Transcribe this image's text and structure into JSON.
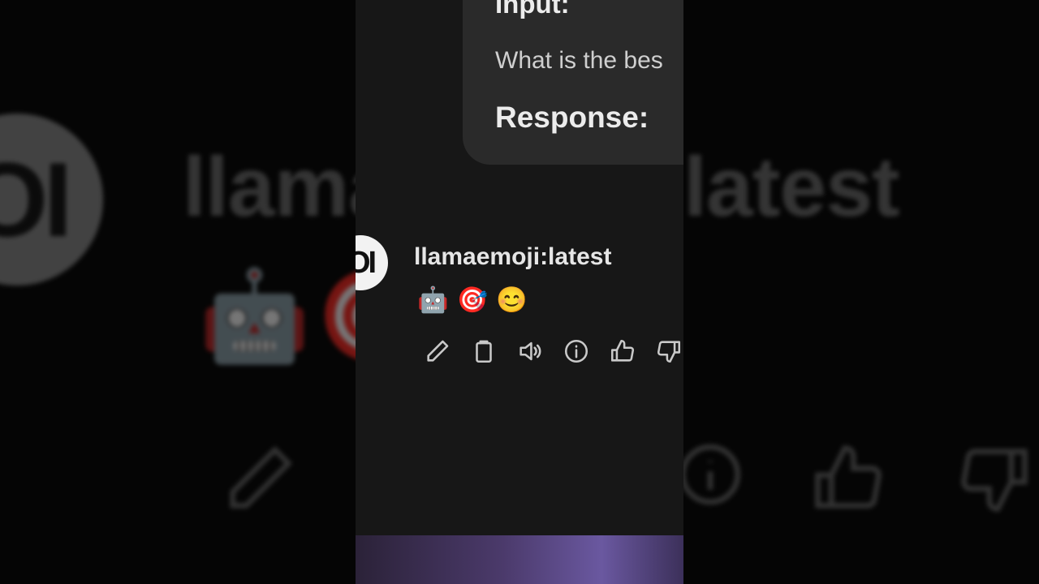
{
  "background": {
    "avatar_text": "OI",
    "title_left": "llama",
    "title_right": "latest",
    "emojis": [
      "🤖",
      "🎯"
    ]
  },
  "chat": {
    "user_message": {
      "input_label": "Input:",
      "text": "What is the bes",
      "response_label": "Response:"
    },
    "assistant_message": {
      "avatar_text": "OI",
      "model_name": "llamaemoji:latest",
      "emojis": [
        "🤖",
        "🎯",
        "😊"
      ]
    },
    "actions": [
      "pencil-icon",
      "clipboard-icon",
      "speaker-icon",
      "info-icon",
      "thumbs-up-icon",
      "thumbs-down-icon"
    ]
  },
  "colors": {
    "column_bg": "#171717",
    "bubble_bg": "#2a2a2a",
    "outer_bg": "#050505"
  }
}
